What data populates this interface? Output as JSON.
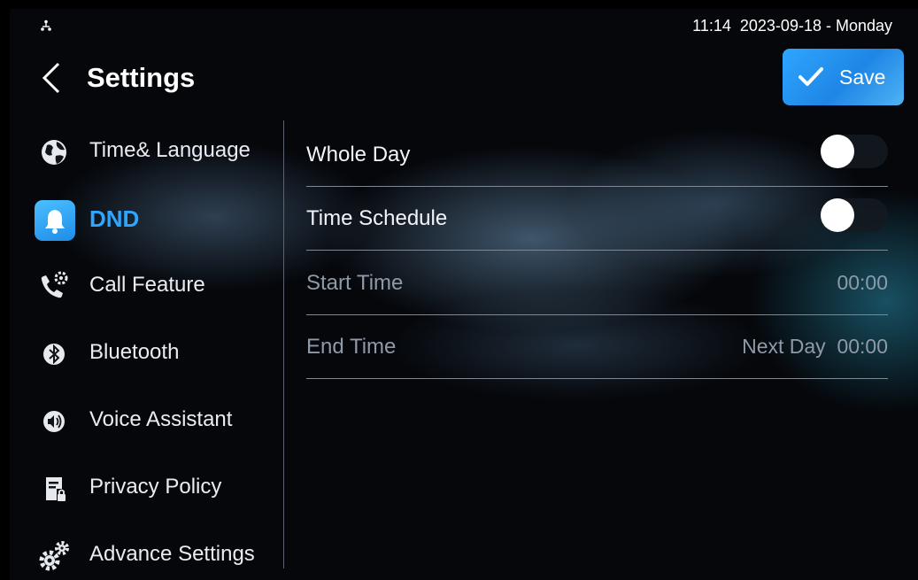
{
  "status_bar": {
    "time": "11:14",
    "date": "2023-09-18 - Monday",
    "network_icon": "network-icon"
  },
  "header": {
    "title": "Settings",
    "back_icon": "chevron-left-icon",
    "save_label": "Save",
    "save_icon": "checkmark-icon",
    "save_color": "#2aa0fb"
  },
  "sidebar": {
    "active_color": "#2ea6ff",
    "items": [
      {
        "label": "Time& Language",
        "icon": "globe-icon",
        "active": false
      },
      {
        "label": "DND",
        "icon": "bell-icon",
        "active": true
      },
      {
        "label": "Call Feature",
        "icon": "phone-gear-icon",
        "active": false
      },
      {
        "label": "Bluetooth",
        "icon": "bluetooth-icon",
        "active": false
      },
      {
        "label": "Voice Assistant",
        "icon": "speaker-icon",
        "active": false
      },
      {
        "label": "Privacy Policy",
        "icon": "document-lock-icon",
        "active": false
      },
      {
        "label": "Advance Settings",
        "icon": "gears-icon",
        "active": false
      }
    ]
  },
  "dnd": {
    "rows": [
      {
        "label": "Whole Day",
        "type": "toggle",
        "on": false
      },
      {
        "label": "Time Schedule",
        "type": "toggle",
        "on": false
      },
      {
        "label": "Start Time",
        "type": "value",
        "value": "00:00",
        "enabled": false
      },
      {
        "label": "End Time",
        "type": "value",
        "value": "Next Day  00:00",
        "enabled": false
      }
    ]
  }
}
